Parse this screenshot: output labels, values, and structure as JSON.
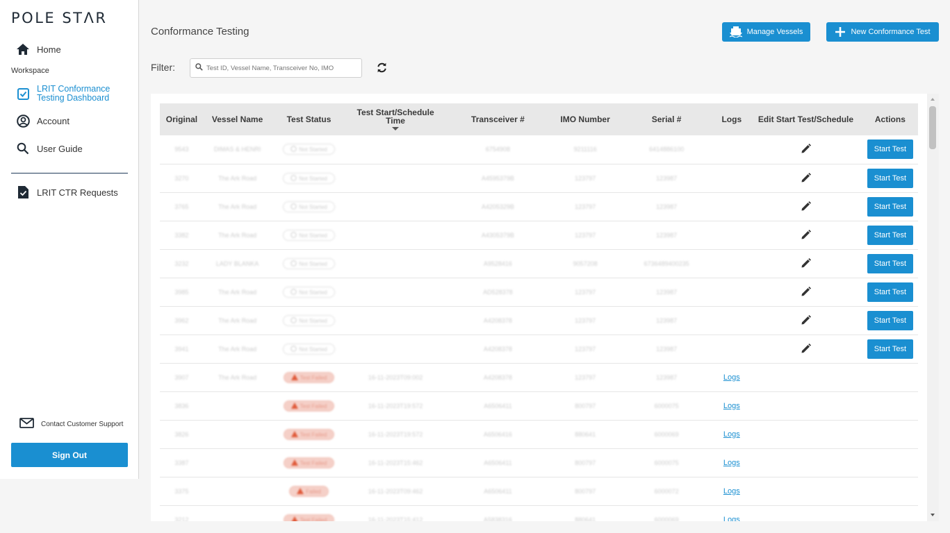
{
  "brand": {
    "logo": "POLE STΛR"
  },
  "sidebar": {
    "home": "Home",
    "section": "Workspace",
    "dashboard_line1": "LRIT Conformance",
    "dashboard_line2": "Testing Dashboard",
    "account": "Account",
    "user_guide": "User Guide",
    "ctr_requests": "LRIT CTR Requests",
    "support": "Contact Customer Support",
    "sign_out": "Sign Out"
  },
  "header": {
    "title": "Conformance Testing",
    "manage_vessels": "Manage Vessels",
    "new_test": "New Conformance Test"
  },
  "filter": {
    "label": "Filter:",
    "placeholder": "Test ID, Vessel Name, Transceiver No, IMO"
  },
  "table": {
    "columns": [
      "Original",
      "Vessel Name",
      "Test Status",
      "Test Start/Schedule Time",
      "Transceiver #",
      "IMO Number",
      "Serial #",
      "Logs",
      "Edit Start Test/Schedule",
      "Actions"
    ],
    "start_label": "Start Test",
    "logs_label": "Logs",
    "rows": [
      {
        "original": "9543",
        "vessel": "DIMAS & HENRI",
        "status": "Not Started",
        "time": "",
        "transceiver": "6754908",
        "imo": "9211116",
        "serial": "6414886100",
        "type": "start"
      },
      {
        "original": "3270",
        "vessel": "The Ark Road",
        "status": "Not Started",
        "time": "",
        "transceiver": "A4595379B",
        "imo": "123797",
        "serial": "123987",
        "type": "start"
      },
      {
        "original": "3765",
        "vessel": "The Ark Road",
        "status": "Not Started",
        "time": "",
        "transceiver": "A4205329B",
        "imo": "123797",
        "serial": "123987",
        "type": "start"
      },
      {
        "original": "3382",
        "vessel": "The Ark Road",
        "status": "Not Started",
        "time": "",
        "transceiver": "A4305379B",
        "imo": "123797",
        "serial": "123987",
        "type": "start"
      },
      {
        "original": "3232",
        "vessel": "LADY BLANKA",
        "status": "Not Started",
        "time": "",
        "transceiver": "A9528416",
        "imo": "9057208",
        "serial": "6736489400235",
        "type": "start"
      },
      {
        "original": "3985",
        "vessel": "The Ark Road",
        "status": "Not Started",
        "time": "",
        "transceiver": "AD528378",
        "imo": "123797",
        "serial": "123987",
        "type": "start"
      },
      {
        "original": "3962",
        "vessel": "The Ark Road",
        "status": "Not Started",
        "time": "",
        "transceiver": "A4208378",
        "imo": "123797",
        "serial": "123987",
        "type": "start"
      },
      {
        "original": "3941",
        "vessel": "The Ark Road",
        "status": "Not Started",
        "time": "",
        "transceiver": "A4208378",
        "imo": "123797",
        "serial": "123987",
        "type": "start"
      },
      {
        "original": "3907",
        "vessel": "The Ark Road",
        "status": "Test Failed",
        "time": "16-11-2023T09:002",
        "transceiver": "A4208378",
        "imo": "123797",
        "serial": "123987",
        "type": "logs"
      },
      {
        "original": "3836",
        "vessel": "",
        "status": "Test Failed",
        "time": "16-11-2023T19:572",
        "transceiver": "A6506411",
        "imo": "800797",
        "serial": "6000075",
        "type": "logs"
      },
      {
        "original": "3826",
        "vessel": "",
        "status": "Test Failed",
        "time": "16-11-2023T19:572",
        "transceiver": "A6506416",
        "imo": "880641",
        "serial": "6000069",
        "type": "logs"
      },
      {
        "original": "3387",
        "vessel": "",
        "status": "Test Failed",
        "time": "16-11-2023T15:462",
        "transceiver": "A6506411",
        "imo": "800797",
        "serial": "6000075",
        "type": "logs"
      },
      {
        "original": "3375",
        "vessel": "",
        "status": "Failed",
        "time": "16-11-2023T09:462",
        "transceiver": "A6506411",
        "imo": "800797",
        "serial": "6000072",
        "type": "logs"
      },
      {
        "original": "3212",
        "vessel": "",
        "status": "Test Failed",
        "time": "16-11-2023T15:412",
        "transceiver": "A5838316",
        "imo": "880641",
        "serial": "6000069",
        "type": "logs"
      }
    ]
  }
}
